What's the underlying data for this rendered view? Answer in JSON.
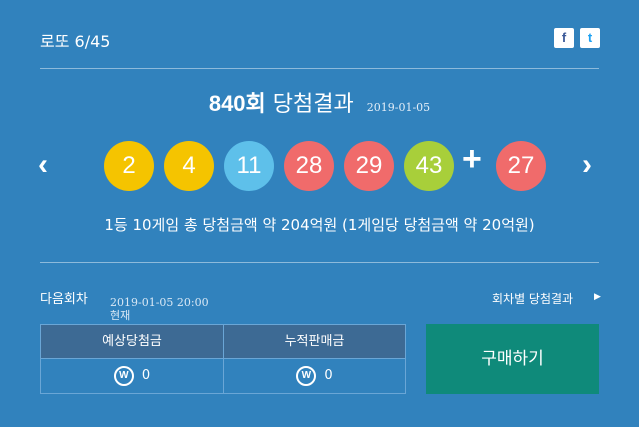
{
  "header": {
    "title": "로또 6/45",
    "facebook": "f",
    "twitter": "t"
  },
  "draw": {
    "round": "840회",
    "label": "당첨결과",
    "date": "2019-01-05"
  },
  "balls": [
    {
      "number": "2",
      "color": "#f5c400"
    },
    {
      "number": "4",
      "color": "#f5c400"
    },
    {
      "number": "11",
      "color": "#5ec0ea"
    },
    {
      "number": "28",
      "color": "#f06b6b"
    },
    {
      "number": "29",
      "color": "#f06b6b"
    },
    {
      "number": "43",
      "color": "#a8cf3a"
    }
  ],
  "plus": "+",
  "bonus": {
    "number": "27",
    "color": "#f06b6b"
  },
  "nav": {
    "prev": "‹",
    "next": "›"
  },
  "prize_info": "1등 10게임 총 당첨금액 약 204억원 (1게임당 당첨금액 약 20억원)",
  "next_draw": {
    "label": "다음회차",
    "time": "2019-01-05 20:00 현재"
  },
  "per_round_link": "회차별 당첨결과",
  "table": {
    "headers": [
      "예상당첨금",
      "누적판매금"
    ],
    "values": [
      "0",
      "0"
    ],
    "currency_icon": "W"
  },
  "buy_button": "구매하기"
}
